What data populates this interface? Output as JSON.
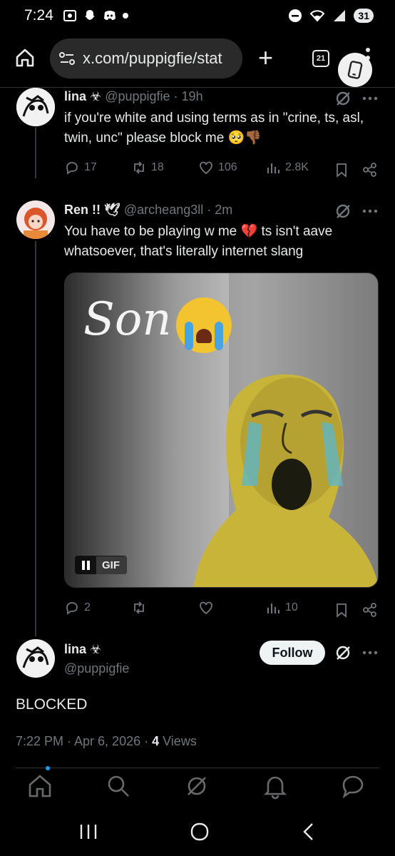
{
  "status_bar": {
    "time": "7:24",
    "battery": "31"
  },
  "browser": {
    "url": "x.com/puppigfie/stat",
    "tab_count": "21"
  },
  "posts": [
    {
      "name": "lina",
      "name_emoji": "☣",
      "handle": "@puppigfie",
      "time": "· 19h",
      "text": "if you're white and using terms as in \"crine,  ts, asl, twin, unc\" please block me 🥺👎🏾",
      "replies": "17",
      "reposts": "18",
      "likes": "106",
      "views": "2.8K"
    },
    {
      "name": "Ren !!",
      "name_emoji": "🕊",
      "handle": "@archeang3ll",
      "time": "· 2m",
      "text": "You have to be playing w me 💔 ts isn't aave whatsoever, that's literally internet slang",
      "gif_caption": "Son",
      "gif_label": "GIF",
      "replies": "2",
      "reposts": "",
      "likes": "",
      "views": "10"
    }
  ],
  "main_post": {
    "name": "lina",
    "name_emoji": "☣",
    "handle": "@puppigfie",
    "follow_label": "Follow",
    "text": "BLOCKED",
    "timestamp": "7:22 PM · Apr 6, 2026 · ",
    "views_count": "4",
    "views_label": " Views"
  },
  "colors": {
    "background": "#000000",
    "muted": "#71767b",
    "text": "#e7e9ea",
    "accent": "#1d9bf0",
    "heart": "#f91880"
  },
  "icons": [
    "home-icon",
    "search-icon",
    "grok-icon",
    "notifications-icon",
    "messages-icon"
  ]
}
